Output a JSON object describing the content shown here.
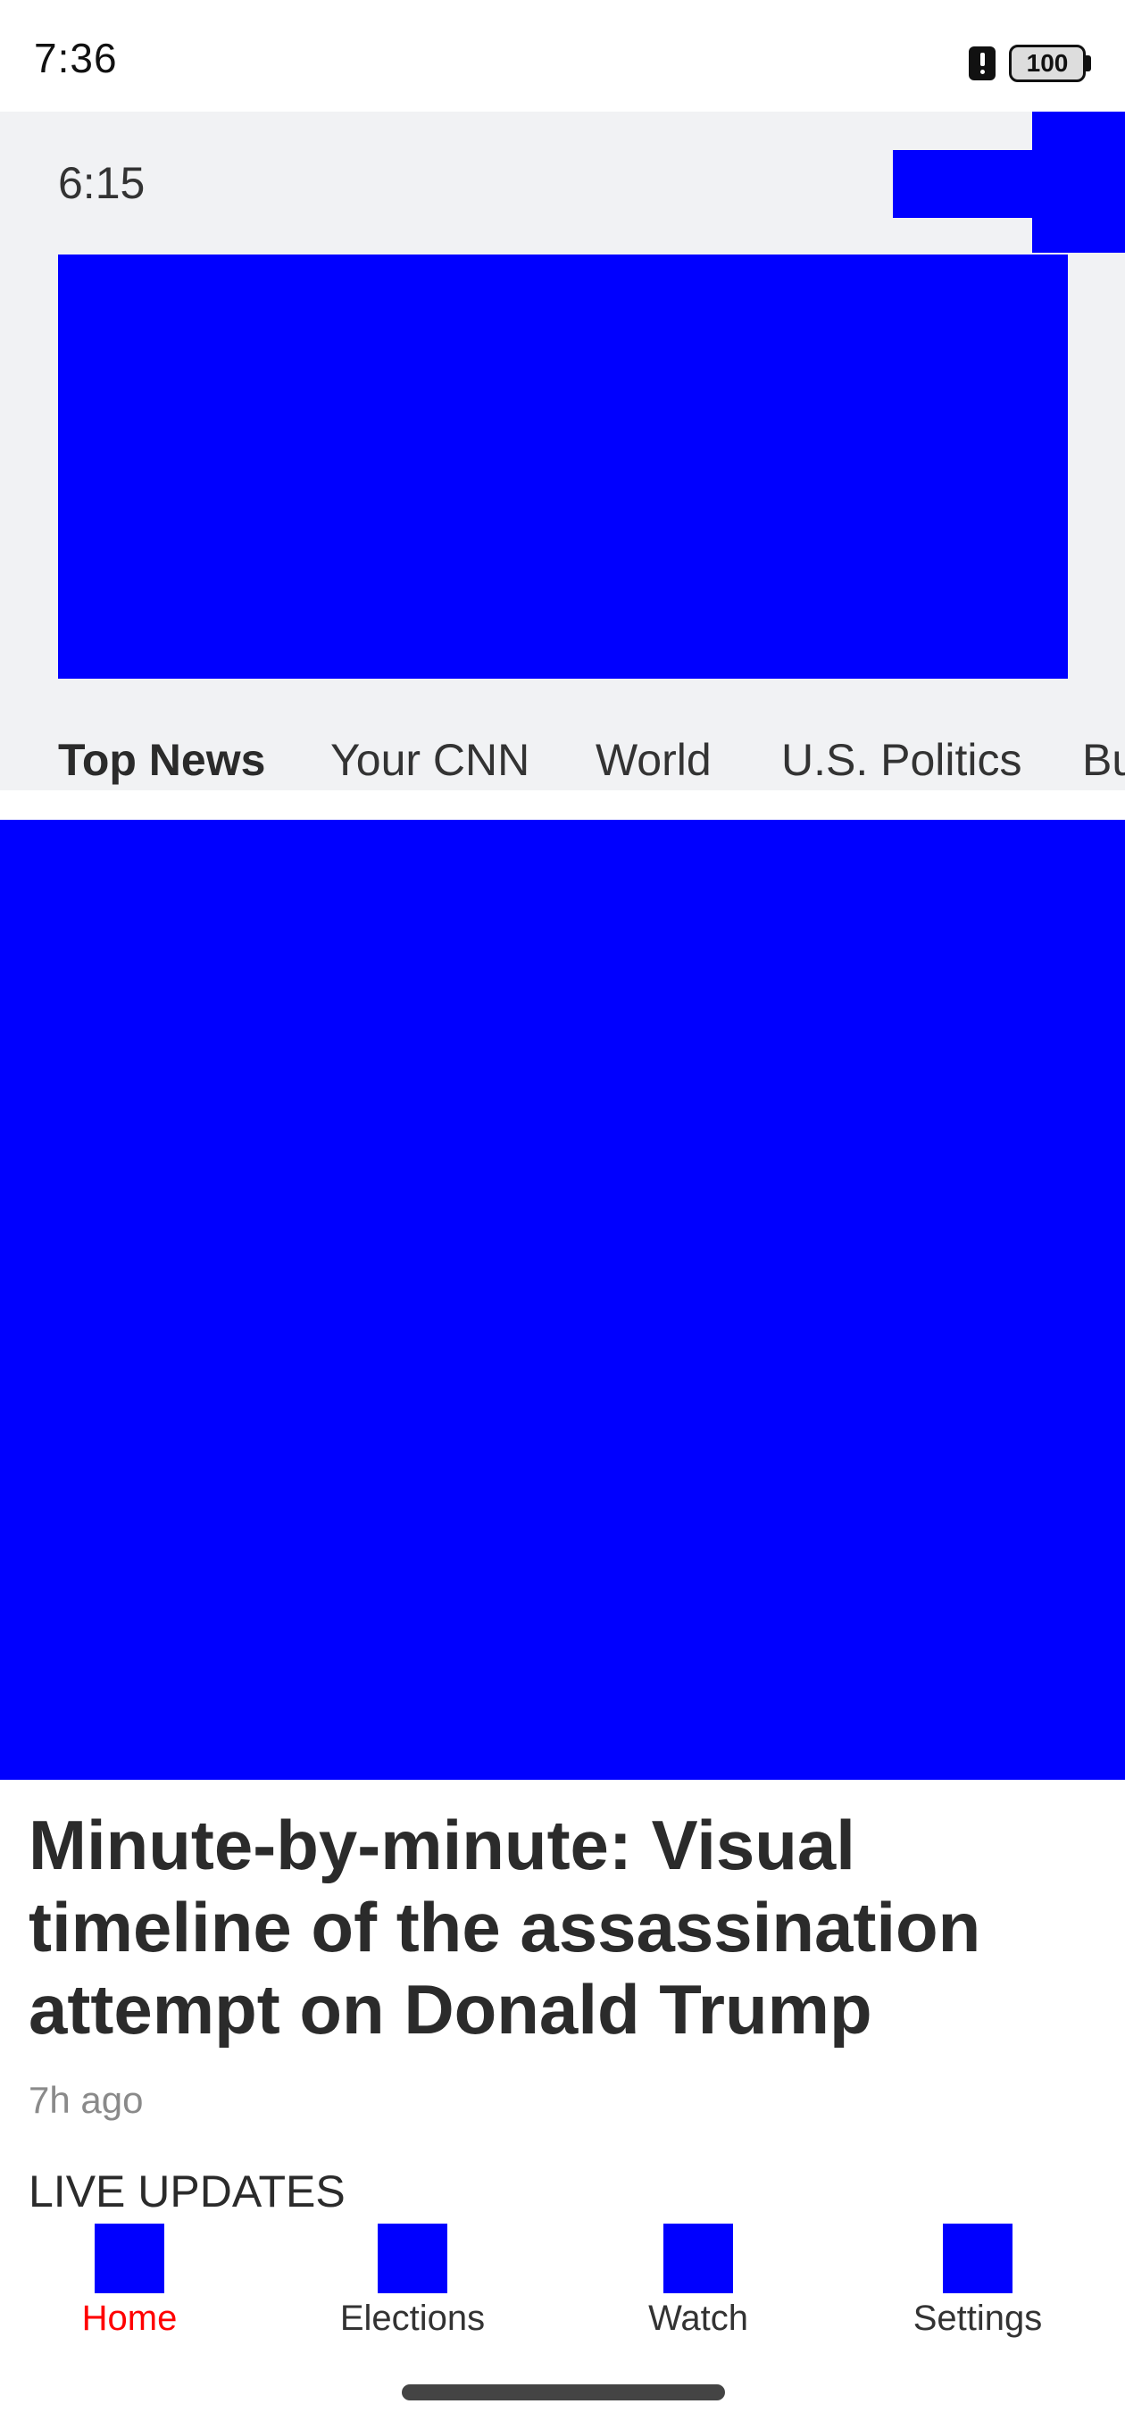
{
  "status_bar": {
    "time": "7:36",
    "battery": "100"
  },
  "header": {
    "live_time": "6:15"
  },
  "tabs": [
    {
      "label": "Top News",
      "active": true
    },
    {
      "label": "Your CNN",
      "active": false
    },
    {
      "label": "World",
      "active": false
    },
    {
      "label": "U.S. Politics",
      "active": false
    },
    {
      "label": "Bu",
      "active": false
    }
  ],
  "article": {
    "headline": "Minute-by-minute: Visual timeline of the assassination attempt on Donald Trump",
    "timestamp": "7h ago",
    "section_label": "LIVE UPDATES"
  },
  "bottom_nav": [
    {
      "label": "Home",
      "active": true
    },
    {
      "label": "Elections",
      "active": false
    },
    {
      "label": "Watch",
      "active": false
    },
    {
      "label": "Settings",
      "active": false
    }
  ],
  "colors": {
    "accent": "#ff0000",
    "placeholder": "#0000ff",
    "header_bg": "#f1f2f4"
  }
}
